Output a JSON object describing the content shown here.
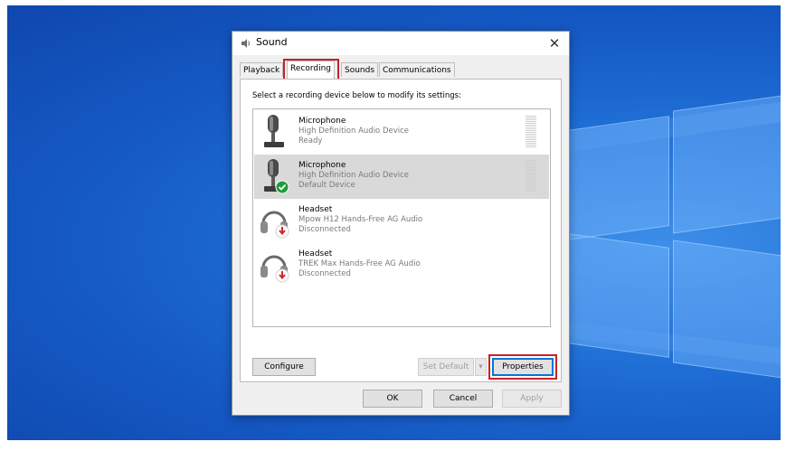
{
  "dialog": {
    "title": "Sound",
    "close_glyph": "✕",
    "tabs": [
      {
        "label": "Playback"
      },
      {
        "label": "Recording"
      },
      {
        "label": "Sounds"
      },
      {
        "label": "Communications"
      }
    ],
    "active_tab": "Recording",
    "instruction": "Select a recording device below to modify its settings:",
    "devices": [
      {
        "name": "Microphone",
        "description": "High Definition Audio Device",
        "status": "Ready",
        "icon": "microphone-icon",
        "selected": false
      },
      {
        "name": "Microphone",
        "description": "High Definition Audio Device",
        "status": "Default Device",
        "icon": "microphone-icon",
        "badge": "default-check-icon",
        "selected": true
      },
      {
        "name": "Headset",
        "description": "Mpow H12 Hands-Free AG Audio",
        "status": "Disconnected",
        "icon": "headset-icon",
        "badge": "disconnected-arrow-icon",
        "selected": false
      },
      {
        "name": "Headset",
        "description": "TREK Max Hands-Free AG Audio",
        "status": "Disconnected",
        "icon": "headset-icon",
        "badge": "disconnected-arrow-icon",
        "selected": false
      }
    ],
    "buttons": {
      "configure": "Configure",
      "set_default": "Set Default",
      "set_default_arrow": "▾",
      "properties": "Properties",
      "ok": "OK",
      "cancel": "Cancel",
      "apply": "Apply"
    }
  },
  "colors": {
    "highlight": "#c8202a",
    "selection": "#d9d9d9",
    "desktop": "#1559c4",
    "check_badge": "#1e9e3a",
    "disconnect_badge": "#d6262d"
  }
}
